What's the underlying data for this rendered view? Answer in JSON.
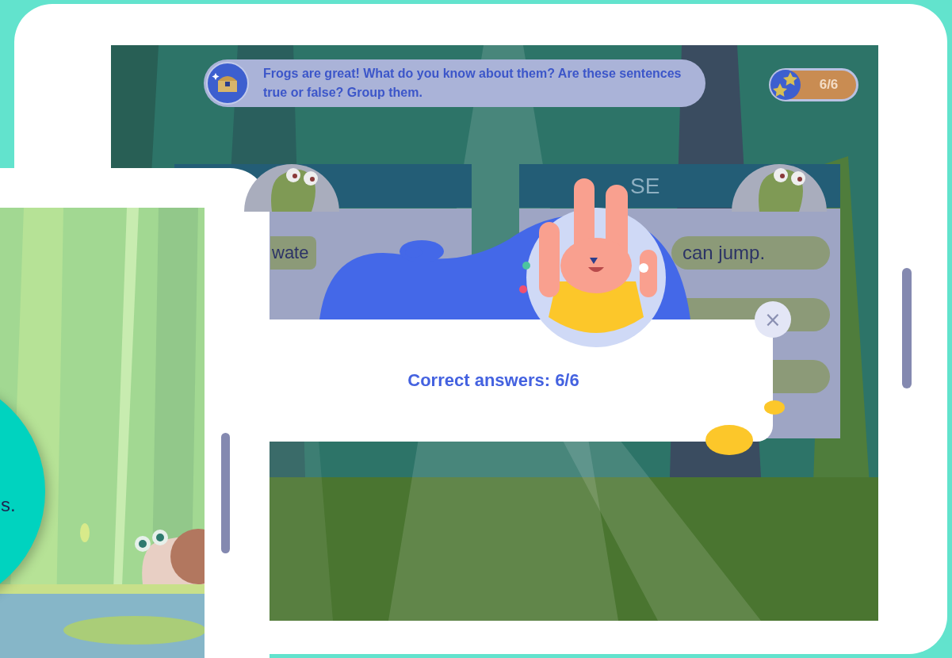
{
  "tablet": {
    "instruction": "Frogs are great! What do you know about them? Are these sentences true or false? Group them.",
    "score": "6/6",
    "groups": [
      {
        "statements": [
          "wate"
        ]
      },
      {
        "heading": "SE",
        "statements": [
          "can jump."
        ]
      }
    ],
    "result_dialog": {
      "message": "Correct answers: 6/6",
      "close": "×"
    }
  },
  "phone": {
    "caption": "s."
  }
}
